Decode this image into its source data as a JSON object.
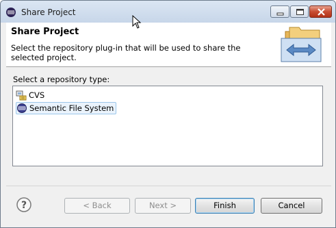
{
  "window": {
    "title": "Share Project"
  },
  "header": {
    "title": "Share Project",
    "description": "Select the repository plug-in that will be used to share the selected project."
  },
  "repository_prompt": "Select a repository type:",
  "repository_types": [
    {
      "label": "CVS",
      "icon": "cvs-repository-icon",
      "selected": false
    },
    {
      "label": "Semantic File System",
      "icon": "semantic-file-system-icon",
      "selected": true
    }
  ],
  "buttons": {
    "back": "< Back",
    "next": "Next >",
    "finish": "Finish",
    "cancel": "Cancel"
  },
  "colors": {
    "selection": "#eaf3fc",
    "selection_border": "#9bc6ea",
    "close_button": "#c84d33"
  }
}
